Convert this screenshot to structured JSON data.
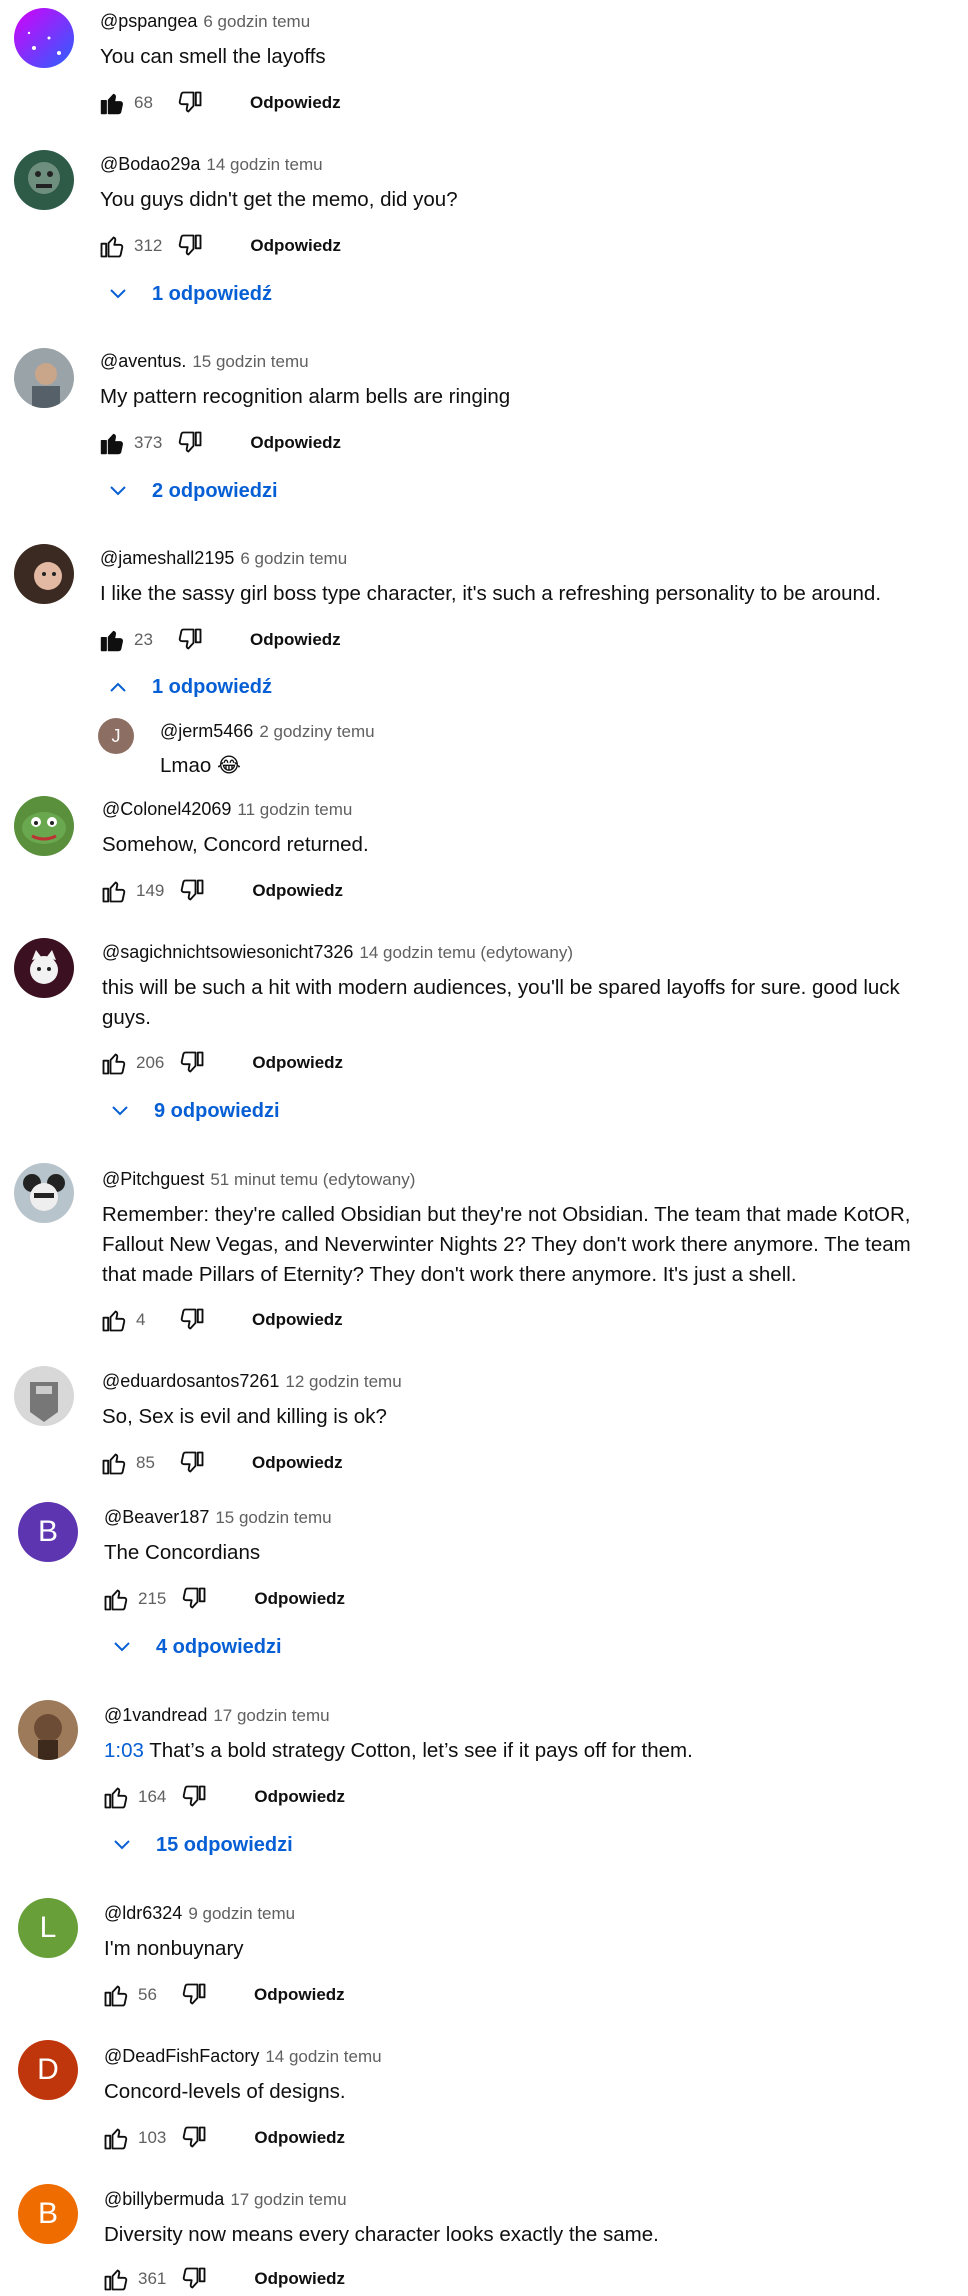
{
  "reply_label": "Odpowiedz",
  "comments": [
    {
      "author": "@pspangea",
      "time": "6 godzin temu",
      "text": "You can smell the layoffs",
      "likes": "68",
      "liked": true,
      "replies": ""
    },
    {
      "author": "@Bodao29a",
      "time": "14 godzin temu",
      "text": "You guys didn't get the memo, did you?",
      "likes": "312",
      "liked": false,
      "replies": "1 odpowiedź"
    },
    {
      "author": "@aventus.",
      "time": "15 godzin temu",
      "text": "My pattern recognition alarm bells are ringing",
      "likes": "373",
      "liked": true,
      "replies": "2 odpowiedzi"
    },
    {
      "author": "@jameshall2195",
      "time": "6 godzin temu",
      "text": "I like the sassy girl boss type character, it's such a refreshing personality to be around.",
      "likes": "23",
      "liked": true,
      "replies": "1 odpowiedź"
    },
    {
      "author": "@Colonel42069",
      "time": "11 godzin temu",
      "text": "Somehow, Concord returned.",
      "likes": "149",
      "liked": false,
      "replies": ""
    },
    {
      "author": "@sagichnichtsowiesonicht7326",
      "time": "14 godzin temu (edytowany)",
      "text_line1": "this will be such a hit with modern audiences, you'll be spared layoffs for sure. good luck",
      "text_line2": "guys.",
      "likes": "206",
      "liked": false,
      "replies": "9 odpowiedzi"
    },
    {
      "author": "@Pitchguest",
      "time": "51 minut temu (edytowany)",
      "text_line1": "Remember: they're called Obsidian but they're not Obsidian. The team that made KotOR,",
      "text_line2": "Fallout New Vegas, and Neverwinter Nights 2? They don't work there anymore. The team",
      "text_line3": "that made Pillars of Eternity? They don't work there anymore. It's just a shell.",
      "likes": "4",
      "liked": false,
      "replies": ""
    },
    {
      "author": "@eduardosantos7261",
      "time": "12 godzin temu",
      "text": "So, Sex is evil and killing is ok?",
      "likes": "85",
      "liked": false,
      "replies": ""
    },
    {
      "author": "@Beaver187",
      "time": "15 godzin temu",
      "text": "The Concordians",
      "likes": "215",
      "liked": false,
      "replies": "4 odpowiedzi",
      "initial": "B",
      "color": "#5e35b1"
    },
    {
      "author": "@1vandread",
      "time": "17 godzin temu",
      "timestamp": "1:03",
      "text": "That’s a bold strategy Cotton, let’s see if it pays off for them.",
      "likes": "164",
      "liked": false,
      "replies": "15 odpowiedzi"
    },
    {
      "author": "@ldr6324",
      "time": "9 godzin temu",
      "text": "I'm nonbuynary",
      "likes": "56",
      "liked": false,
      "replies": "",
      "initial": "L",
      "color": "#689f38"
    },
    {
      "author": "@DeadFishFactory",
      "time": "14 godzin temu",
      "text": "Concord-levels of designs.",
      "likes": "103",
      "liked": false,
      "replies": "",
      "initial": "D",
      "color": "#bf360c"
    },
    {
      "author": "@billybermuda",
      "time": "17 godzin temu",
      "text": "Diversity now means every character looks exactly the same.",
      "likes": "361",
      "liked": false,
      "replies": "",
      "initial": "B",
      "color": "#ef6c00"
    }
  ],
  "nested_reply": {
    "author": "@jerm5466",
    "time": "2 godziny temu",
    "text": "Lmao 😂",
    "initial": "J",
    "color": "#8d6e63"
  }
}
